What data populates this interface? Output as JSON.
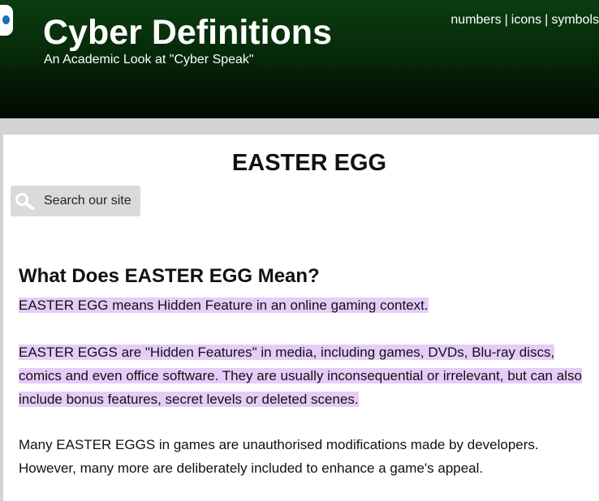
{
  "header": {
    "title": "Cyber Definitions",
    "subtitle": "An Academic Look at \"Cyber Speak\"",
    "nav": [
      {
        "label": "numbers"
      },
      {
        "label": "icons"
      },
      {
        "label": "symbols"
      }
    ],
    "separator": "|",
    "background_colors": [
      "#0b3d10",
      "#010901"
    ]
  },
  "main": {
    "term_title": "EASTER EGG",
    "search": {
      "label": "Search our site",
      "icon": "search-icon"
    },
    "meaning_heading": "What Does EASTER EGG Mean?",
    "paragraphs": [
      "EASTER EGG means Hidden Feature in an online gaming context.",
      "EASTER EGGS are \"Hidden Features\" in media, including games, DVDs, Blu-ray discs, comics and even office software. They are usually inconsequential or irrelevant, but can also include bonus features, secret levels or deleted scenes.",
      "Many EASTER EGGS in games are unauthorised modifications made by developers. However, many more are deliberately included to enhance a game's appeal."
    ],
    "highlight_color": "#e7ccfa"
  }
}
